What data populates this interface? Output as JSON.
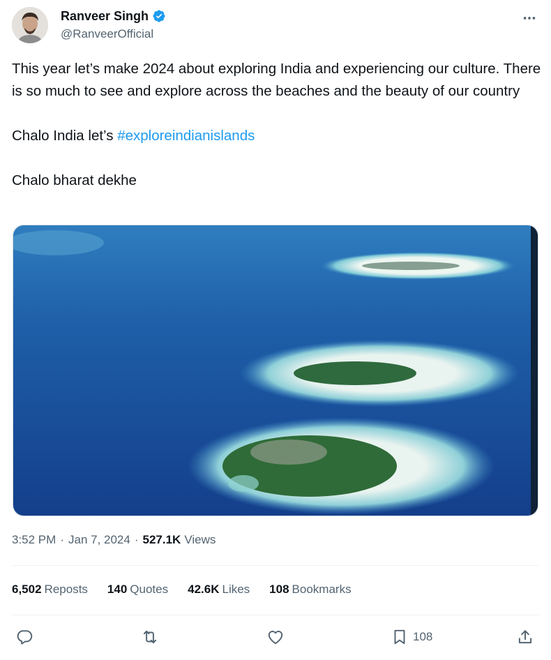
{
  "author": {
    "display_name": "Ranveer Singh",
    "handle": "@RanveerOfficial",
    "verified_color": "#1d9bf0"
  },
  "more_icon": "more-horizontal-icon",
  "tweet": {
    "line1": "This year let’s make 2024 about exploring India and experiencing our culture. There is so much to see and explore across the beaches and the beauty of our country",
    "line2_prefix": "Chalo India let’s ",
    "hashtag": "#exploreindianislands",
    "line3": "Chalo bharat dekhe"
  },
  "meta": {
    "time": "3:52 PM",
    "date": "Jan 7, 2024",
    "separator": "·",
    "views_count": "527.1K",
    "views_label": "Views"
  },
  "stats": {
    "reposts_count": "6,502",
    "reposts_label": "Reposts",
    "quotes_count": "140",
    "quotes_label": "Quotes",
    "likes_count": "42.6K",
    "likes_label": "Likes",
    "bookmarks_count": "108",
    "bookmarks_label": "Bookmarks"
  },
  "actions": {
    "reply_icon": "reply-icon",
    "repost_icon": "repost-icon",
    "like_icon": "heart-icon",
    "bookmark_icon": "bookmark-icon",
    "bookmark_count": "108",
    "share_icon": "share-icon"
  },
  "colors": {
    "link": "#1d9bf0",
    "secondary_text": "#536471",
    "primary_text": "#0f1419"
  }
}
